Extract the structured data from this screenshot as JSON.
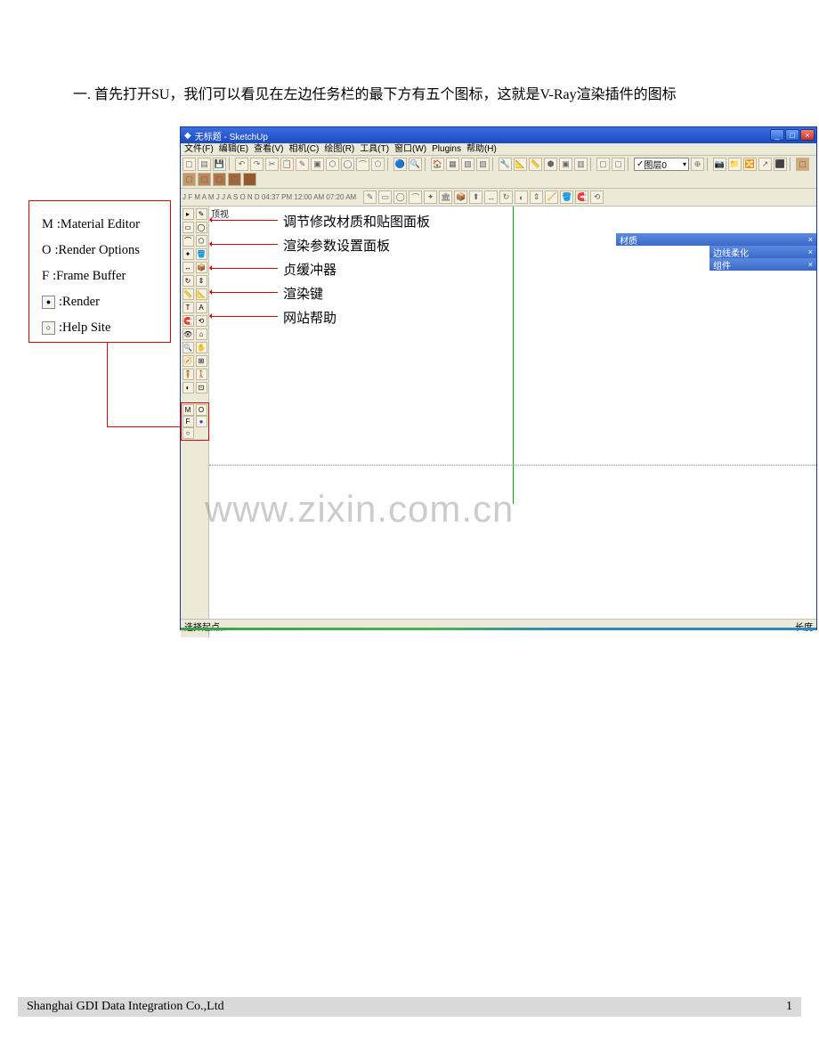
{
  "intro_text": "一. 首先打开SU，我们可以看见在左边任务栏的最下方有五个图标，这就是V-Ray渲染插件的图标",
  "legend": {
    "items": [
      {
        "code": "M",
        "label": ":Material Editor"
      },
      {
        "code": "O",
        "label": ":Render Options"
      },
      {
        "code": "F",
        "label": ":Frame Buffer"
      },
      {
        "code": "●",
        "label": ":Render"
      },
      {
        "code": "○",
        "label": ":Help Site"
      }
    ]
  },
  "annotations": [
    "调节修改材质和贴图面板",
    "渲染参数设置面板",
    "贞缓冲器",
    "渲染键",
    "网站帮助"
  ],
  "app": {
    "title": "无标题 - SketchUp",
    "menu": [
      "文件(F)",
      "编辑(E)",
      "查看(V)",
      "相机(C)",
      "绘图(R)",
      "工具(T)",
      "窗口(W)",
      "Plugins",
      "帮助(H)"
    ],
    "layer_selected": "图层0",
    "time_strip": "J F M A M J J A S O N D   04:37 PM   12:00 AM   07:20 AM",
    "viewport_label": "顶视",
    "panels": [
      {
        "title": "材质"
      },
      {
        "title": "边线柔化"
      },
      {
        "title": "组件"
      }
    ],
    "status_left": "选择起点。",
    "status_right": "长度"
  },
  "vray_buttons": [
    "M",
    "O",
    "F",
    "●",
    "○"
  ],
  "watermark": "www.zixin.com.cn",
  "footer": {
    "company": "Shanghai GDI Data Integration Co.,Ltd",
    "page": "1"
  }
}
